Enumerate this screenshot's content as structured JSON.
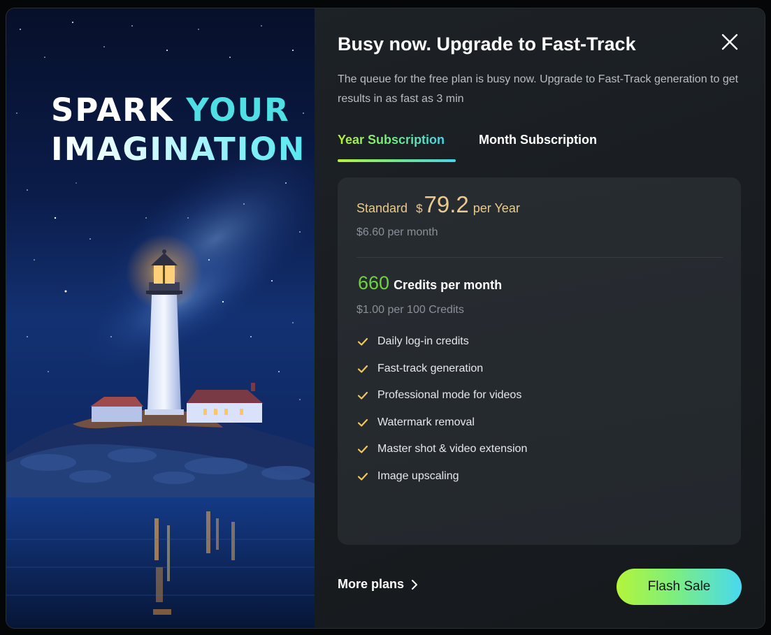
{
  "hero": {
    "headline_line1_a": "SPARK ",
    "headline_line1_b": "YOUR",
    "headline_line2": "IMAGINATION"
  },
  "dialog": {
    "title": "Busy now. Upgrade to Fast-Track",
    "description": "The queue for the free plan is busy now. Upgrade to Fast-Track generation to get results in as fast as 3 min",
    "close_icon": "close-icon"
  },
  "tabs": [
    {
      "label": "Year Subscription",
      "active": true
    },
    {
      "label": "Month Subscription",
      "active": false
    }
  ],
  "plan": {
    "name": "Standard",
    "currency": "$",
    "price": "79.2",
    "period": "per Year",
    "monthly": "$6.60 per month",
    "credits_amount": "660",
    "credits_unit": "Credits per month",
    "credits_rate": "$1.00 per 100 Credits",
    "features": [
      "Daily log-in credits",
      "Fast-track generation",
      "Professional mode for videos",
      "Watermark removal",
      "Master shot & video extension",
      "Image upscaling"
    ]
  },
  "footer": {
    "more_plans": "More plans",
    "flash_sale": "Flash Sale"
  },
  "colors": {
    "price_gold": "#ecc98c",
    "credits_green": "#6fd13f",
    "check_gold": "#f2c75c",
    "accent_gradient_start": "#b7f23f",
    "accent_gradient_end": "#48d3ec"
  }
}
